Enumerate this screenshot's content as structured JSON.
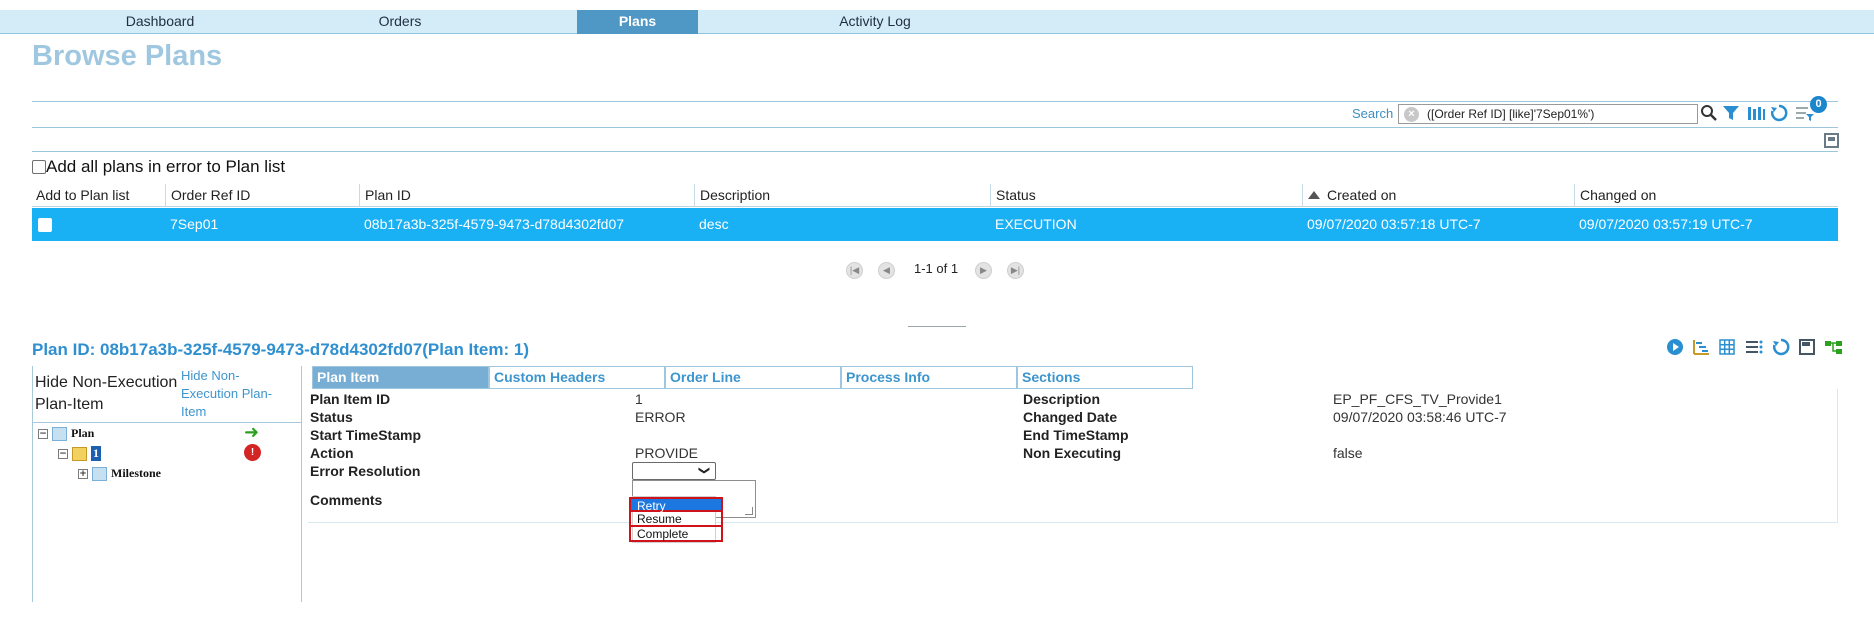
{
  "nav": {
    "tabs": [
      {
        "label": "Dashboard"
      },
      {
        "label": "Orders"
      },
      {
        "label": "Plans"
      },
      {
        "label": "Activity Log"
      }
    ],
    "active": "Plans"
  },
  "page": {
    "title": "Browse Plans"
  },
  "search": {
    "label": "Search",
    "query": "([Order Ref ID] [like]'7Sep01%')",
    "filter_count": "0"
  },
  "add_all": {
    "label": "Add all plans in error to Plan list"
  },
  "table": {
    "columns": [
      "Add to Plan list",
      "Order Ref ID",
      "Plan ID",
      "Description",
      "Status",
      "Created on",
      "Changed on"
    ],
    "rows": [
      {
        "order_ref_id": "7Sep01",
        "plan_id": "08b17a3b-325f-4579-9473-d78d4302fd07",
        "description": "desc",
        "status": "EXECUTION",
        "created_on": "09/07/2020 03:57:18 UTC-7",
        "changed_on": "09/07/2020 03:57:19 UTC-7"
      }
    ]
  },
  "pager": {
    "text": "1-1 of 1"
  },
  "detail": {
    "title": "Plan ID: 08b17a3b-325f-4579-9473-d78d4302fd07(Plan Item: 1)",
    "tree": {
      "image_alt": "Hide Non-Execution Plan-Item",
      "hide_link": "Hide Non-Execution Plan-Item",
      "nodes": [
        "Plan",
        "1",
        "Milestone"
      ]
    },
    "tabs": [
      "Plan Item",
      "Custom Headers",
      "Order Line",
      "Process Info",
      "Sections"
    ],
    "fields": {
      "plan_item_id_label": "Plan Item ID",
      "plan_item_id": "1",
      "status_label": "Status",
      "status": "ERROR",
      "start_label": "Start TimeStamp",
      "action_label": "Action",
      "action": "PROVIDE",
      "error_resolution_label": "Error Resolution",
      "comments_label": "Comments",
      "description_label": "Description",
      "description": "EP_PF_CFS_TV_Provide1",
      "changed_date_label": "Changed Date",
      "changed_date": "09/07/2020 03:58:46 UTC-7",
      "end_label": "End TimeStamp",
      "non_exec_label": "Non Executing",
      "non_exec": "false"
    },
    "error_resolution_options": [
      "Retry",
      "Resume",
      "Complete"
    ],
    "error_resolution_selected": "Retry"
  },
  "colors": {
    "accent": "#2f8fcf",
    "row_selected": "#1ab0f4",
    "nav_bg": "#d4ecf8",
    "nav_active": "#4f97c4",
    "highlight_outline": "#d0131a"
  }
}
